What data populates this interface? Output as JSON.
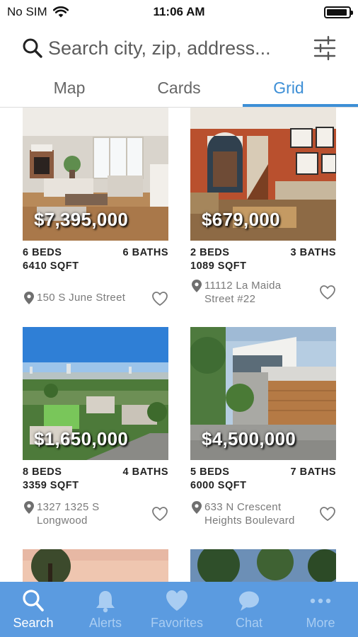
{
  "status_bar": {
    "carrier": "No SIM",
    "time": "11:06 AM",
    "wifi_icon": "wifi-icon",
    "battery_icon": "battery-icon"
  },
  "search": {
    "placeholder": "Search city, zip, address...",
    "value": "",
    "search_icon": "magnifier-icon",
    "filter_icon": "sliders-icon"
  },
  "tabs": [
    {
      "label": "Map",
      "active": false
    },
    {
      "label": "Cards",
      "active": false
    },
    {
      "label": "Grid",
      "active": true
    }
  ],
  "listings": [
    {
      "price": "$7,395,000",
      "beds": "6 BEDS",
      "baths": "6 BATHS",
      "sqft": "6410 SQFT",
      "address_line1": "150 S June Street",
      "address_line2": ""
    },
    {
      "price": "$679,000",
      "beds": "2 BEDS",
      "baths": "3 BATHS",
      "sqft": "1089 SQFT",
      "address_line1": "11112 La Maida",
      "address_line2": "Street #22"
    },
    {
      "price": "$1,650,000",
      "beds": "8 BEDS",
      "baths": "4 BATHS",
      "sqft": "3359 SQFT",
      "address_line1": "1327 1325 S",
      "address_line2": "Longwood"
    },
    {
      "price": "$4,500,000",
      "beds": "5 BEDS",
      "baths": "7 BATHS",
      "sqft": "6000 SQFT",
      "address_line1": "633 N Crescent",
      "address_line2": "Heights Boulevard"
    }
  ],
  "bottom_nav": [
    {
      "label": "Search",
      "icon": "search-icon",
      "active": true
    },
    {
      "label": "Alerts",
      "icon": "bell-icon",
      "active": false
    },
    {
      "label": "Favorites",
      "icon": "heart-icon",
      "active": false
    },
    {
      "label": "Chat",
      "icon": "chat-bubble-icon",
      "active": false
    },
    {
      "label": "More",
      "icon": "more-dots-icon",
      "active": false
    }
  ],
  "colors": {
    "accent": "#3d8fd6",
    "nav_background": "#5b9be0",
    "nav_active": "#ffffff",
    "nav_inactive": "#a9cdf2"
  }
}
